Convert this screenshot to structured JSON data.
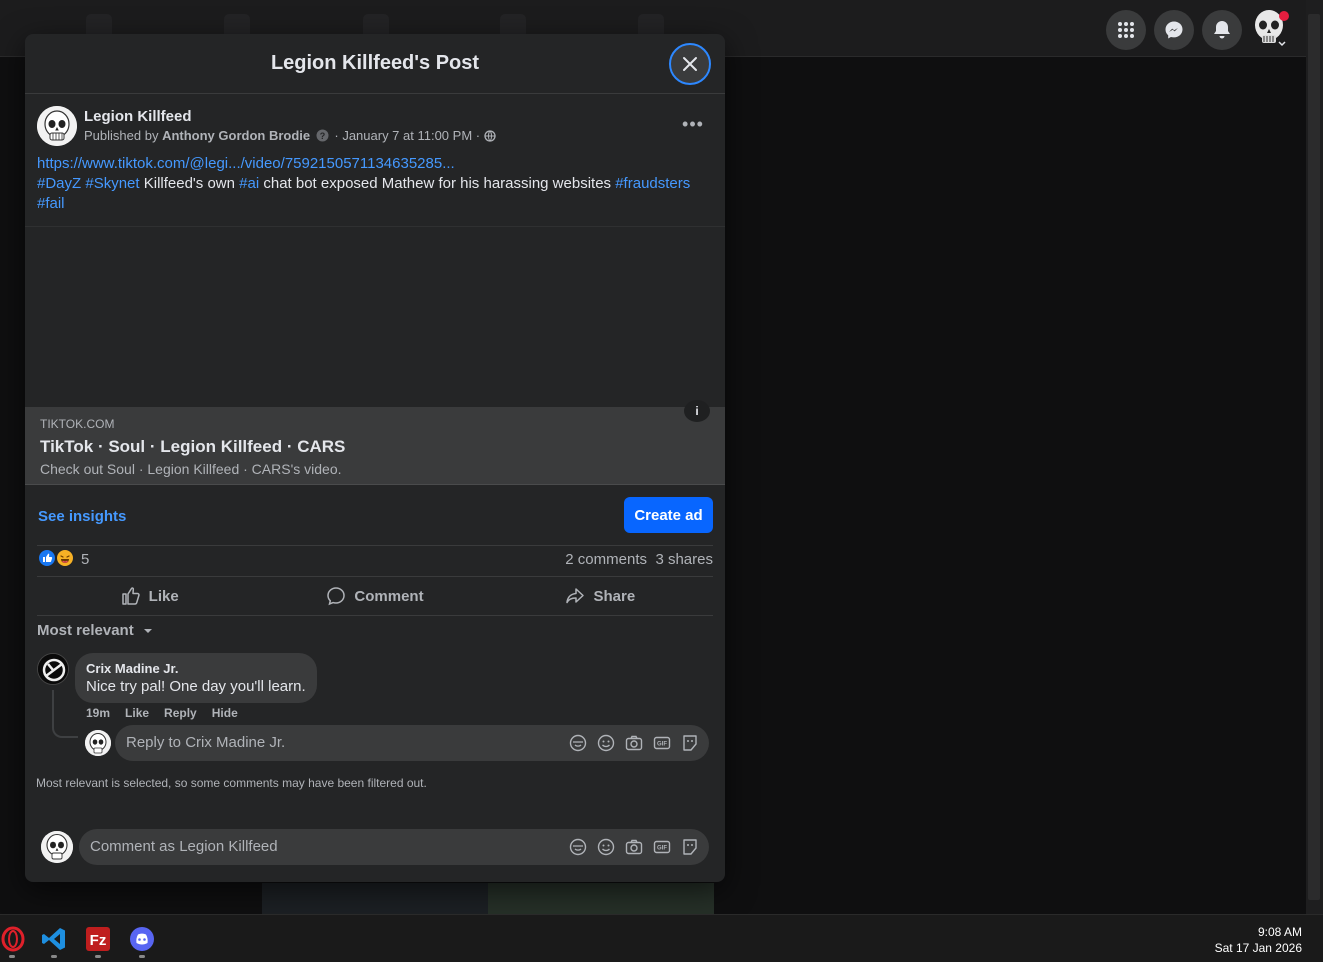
{
  "modal": {
    "title": "Legion Killfeed's Post"
  },
  "post": {
    "author": "Legion Killfeed",
    "published_prefix": "Published by",
    "publisher": "Anthony Gordon Brodie",
    "date": "· January 7 at 11:00 PM ·",
    "link": "https://www.tiktok.com/@legi.../video/7592150571134635285...",
    "text_segments": {
      "tag1": "#DayZ",
      "tag2": "#Skynet",
      "plain1": " Killfeed's own ",
      "tag3": "#ai",
      "plain2": " chat bot exposed Mathew for his harassing websites ",
      "tag4": "#fraudsters",
      "tag5": "#fail"
    }
  },
  "link_card": {
    "badge": "i",
    "domain": "TIKTOK.COM",
    "title": "TikTok · Soul · Legion Killfeed · CARS",
    "description": "Check out Soul · Legion Killfeed · CARS's video."
  },
  "insights": {
    "see_insights": "See insights",
    "create_ad": "Create ad"
  },
  "stats": {
    "reactions": "5",
    "comments": "2 comments",
    "shares": "3 shares"
  },
  "actions": {
    "like": "Like",
    "comment": "Comment",
    "share": "Share"
  },
  "comments": {
    "sort_label": "Most relevant",
    "items": [
      {
        "name": "Crix Madine Jr.",
        "text": "Nice try pal! One day you'll learn.",
        "time": "19m",
        "like": "Like",
        "reply": "Reply",
        "hide": "Hide"
      }
    ],
    "reply_placeholder": "Reply to Crix Madine Jr.",
    "filter_note": "Most relevant is selected, so some comments may have been filtered out.",
    "comment_placeholder": "Comment as Legion Killfeed"
  },
  "taskbar": {
    "apps": [
      "opera-icon",
      "vscode-icon",
      "filezilla-icon",
      "discord-icon"
    ],
    "time": "9:08 AM",
    "date": "Sat 17 Jan 2026"
  },
  "colors": {
    "accent": "#0866ff",
    "link": "#4599ff",
    "surface": "#242526",
    "notification": "#e41e3f"
  }
}
